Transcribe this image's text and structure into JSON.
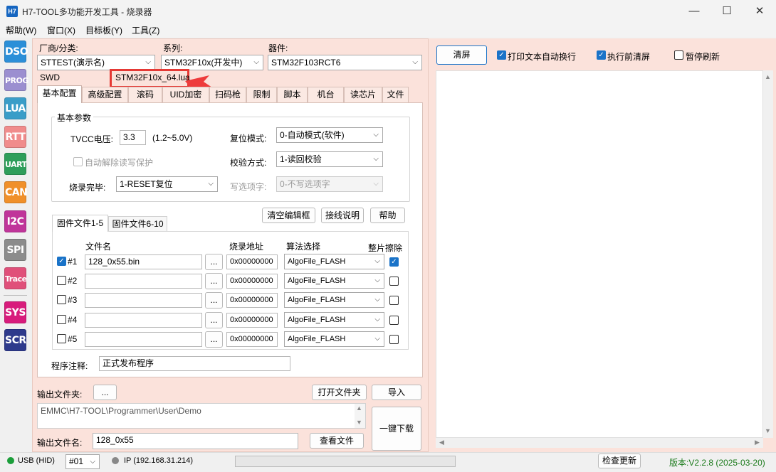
{
  "window": {
    "app_icon": "H7",
    "title": "H7-TOOL多功能开发工具 - 烧录器",
    "minimize": "—",
    "maximize": "☐",
    "close": "✕"
  },
  "menu": [
    "帮助(W)",
    "窗口(X)",
    "目标板(Y)",
    "工具(Z)"
  ],
  "sidebar": [
    {
      "label": "DSO",
      "color": "#2b8fd8"
    },
    {
      "label": "PROG",
      "color": "#9b8fd0"
    },
    {
      "label": "LUA",
      "color": "#3a9dc8"
    },
    {
      "label": "RTT",
      "color": "#f08c8c"
    },
    {
      "label": "UART",
      "color": "#2e9e5b"
    },
    {
      "label": "CAN",
      "color": "#f0902a"
    },
    {
      "label": "I2C",
      "color": "#c0359a"
    },
    {
      "label": "SPI",
      "color": "#8c8c8c"
    },
    {
      "label": "Trace",
      "color": "#e0507a"
    },
    {
      "label": "SYS",
      "color": "#d81c7c"
    },
    {
      "label": "SCR",
      "color": "#2e3a8c"
    }
  ],
  "selectors": {
    "vendor_label": "厂商/分类:",
    "vendor_value": "STTEST(演示名)",
    "series_label": "系列:",
    "series_value": "STM32F10x(开发中)",
    "device_label": "器件:",
    "device_value": "STM32F103RCT6",
    "interface": "SWD",
    "lua_file": "STM32F10x_64.lua"
  },
  "tabs": [
    "基本配置",
    "高级配置",
    "滚码",
    "UID加密",
    "扫码枪",
    "限制",
    "脚本",
    "机台",
    "读芯片",
    "文件"
  ],
  "basic": {
    "group_title": "基本参数",
    "tvcc_label": "TVCC电压:",
    "tvcc_value": "3.3",
    "tvcc_range": "(1.2~5.0V)",
    "reset_label": "复位模式:",
    "reset_value": "0-自动模式(软件)",
    "auto_unlock_label": "自动解除读写保护",
    "verify_label": "校验方式:",
    "verify_value": "1-读回校验",
    "after_label": "烧录完毕:",
    "after_value": "1-RESET复位",
    "option_label": "写选项字:",
    "option_value": "0-不写选项字"
  },
  "buttons": {
    "clear_editor": "清空编辑框",
    "wiring": "接线说明",
    "help": "帮助",
    "browse": "...",
    "open_folder": "打开文件夹",
    "import": "导入",
    "one_key": "一键下载",
    "view_file": "查看文件",
    "clear_screen": "清屏",
    "check_update": "检查更新"
  },
  "file_tabs": [
    "固件文件1-5",
    "固件文件6-10"
  ],
  "file_table": {
    "headers": {
      "name": "文件名",
      "addr": "烧录地址",
      "algo": "算法选择",
      "erase": "整片擦除"
    },
    "rows": [
      {
        "index": "#1",
        "enabled": true,
        "file": "128_0x55.bin",
        "addr": "0x00000000",
        "algo": "AlgoFile_FLASH",
        "erase": true
      },
      {
        "index": "#2",
        "enabled": false,
        "file": "",
        "addr": "0x00000000",
        "algo": "AlgoFile_FLASH",
        "erase": false
      },
      {
        "index": "#3",
        "enabled": false,
        "file": "",
        "addr": "0x00000000",
        "algo": "AlgoFile_FLASH",
        "erase": false
      },
      {
        "index": "#4",
        "enabled": false,
        "file": "",
        "addr": "0x00000000",
        "algo": "AlgoFile_FLASH",
        "erase": false
      },
      {
        "index": "#5",
        "enabled": false,
        "file": "",
        "addr": "0x00000000",
        "algo": "AlgoFile_FLASH",
        "erase": false
      }
    ]
  },
  "comment": {
    "label": "程序注释:",
    "value": "正式发布程序"
  },
  "output": {
    "folder_label": "输出文件夹:",
    "folder_path": "EMMC\\H7-TOOL\\Programmer\\User\\Demo",
    "filename_label": "输出文件名:",
    "filename_value": "128_0x55"
  },
  "right": {
    "wrap_label": "打印文本自动换行",
    "clear_before_label": "执行前清屏",
    "pause_label": "暂停刷新"
  },
  "status": {
    "usb": "USB (HID)",
    "device_no": "#01",
    "ip": "IP (192.168.31.214)",
    "version": "版本:V2.2.8 (2025-03-20)"
  },
  "colors": {
    "panel": "#fbe2db",
    "highlight": "#e53935",
    "check": "#1a73c8",
    "version": "#1a7a1a"
  }
}
